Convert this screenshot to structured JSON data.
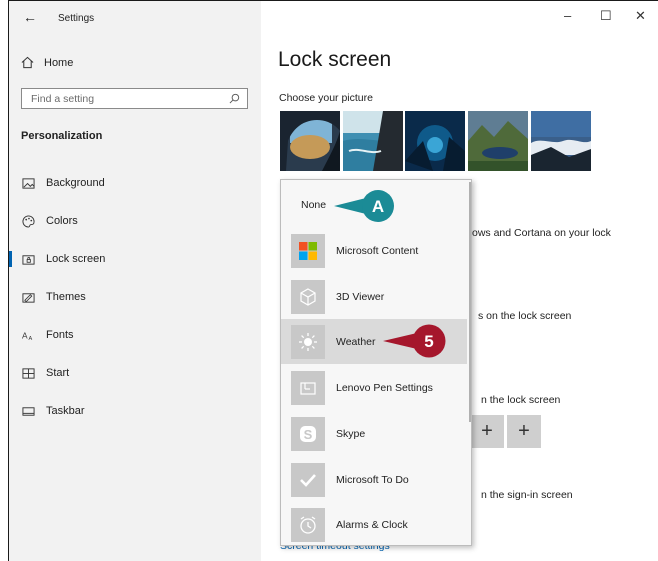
{
  "window": {
    "back_glyph": "←",
    "title": "Settings",
    "minimize": "–",
    "maximize": "☐",
    "close": "✕"
  },
  "sidebar": {
    "home_label": "Home",
    "search_placeholder": "Find a setting",
    "section_title": "Personalization",
    "items": [
      {
        "label": "Background",
        "icon": "background-icon"
      },
      {
        "label": "Colors",
        "icon": "palette-icon"
      },
      {
        "label": "Lock screen",
        "icon": "lock-screen-icon",
        "active": true
      },
      {
        "label": "Themes",
        "icon": "themes-icon"
      },
      {
        "label": "Fonts",
        "icon": "fonts-icon"
      },
      {
        "label": "Start",
        "icon": "start-icon"
      },
      {
        "label": "Taskbar",
        "icon": "taskbar-icon"
      }
    ]
  },
  "main": {
    "page_title": "Lock screen",
    "choose_picture_label": "Choose your picture",
    "partial_texts": {
      "cortana": "ows and Cortana on your lock",
      "detailed_status": "s on the lock screen",
      "quick_status": "n the lock screen",
      "signin": "n the sign-in screen"
    },
    "add_glyph": "+",
    "screen_timeout_link": "Screen timeout settings"
  },
  "dropdown": {
    "none_label": "None",
    "items": [
      {
        "label": "Microsoft Content",
        "icon": "microsoft-logo-icon"
      },
      {
        "label": "3D Viewer",
        "icon": "cube-icon"
      },
      {
        "label": "Weather",
        "icon": "sun-icon",
        "highlighted": true
      },
      {
        "label": "Lenovo Pen Settings",
        "icon": "pen-settings-icon"
      },
      {
        "label": "Skype",
        "icon": "skype-icon"
      },
      {
        "label": "Microsoft To Do",
        "icon": "checkmark-icon"
      },
      {
        "label": "Alarms & Clock",
        "icon": "clock-icon"
      }
    ]
  },
  "callouts": {
    "a_label": "A",
    "five_label": "5",
    "a_color": "#1b8b96",
    "five_color": "#a5172c"
  }
}
